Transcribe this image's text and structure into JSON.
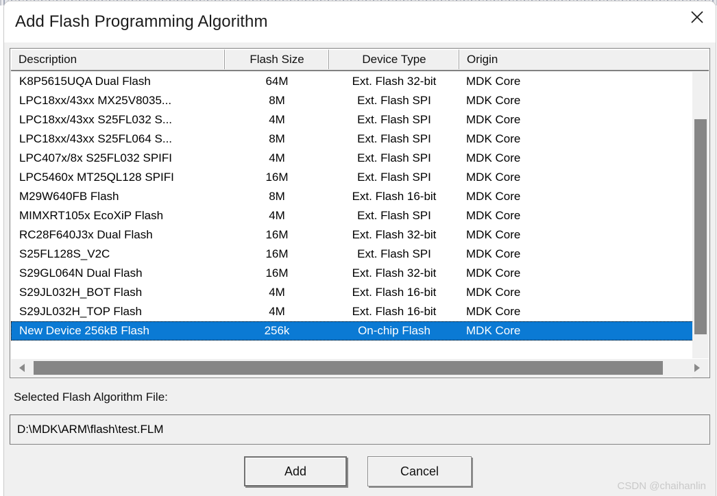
{
  "dialog": {
    "title": "Add Flash Programming Algorithm",
    "close_icon": "close-icon"
  },
  "table": {
    "columns": [
      "Description",
      "Flash Size",
      "Device Type",
      "Origin"
    ],
    "rows": [
      {
        "description": "K8P5615UQA Dual Flash",
        "flash_size": "64M",
        "device_type": "Ext. Flash 32-bit",
        "origin": "MDK Core",
        "selected": false
      },
      {
        "description": "LPC18xx/43xx MX25V8035...",
        "flash_size": "8M",
        "device_type": "Ext. Flash SPI",
        "origin": "MDK Core",
        "selected": false
      },
      {
        "description": "LPC18xx/43xx S25FL032 S...",
        "flash_size": "4M",
        "device_type": "Ext. Flash SPI",
        "origin": "MDK Core",
        "selected": false
      },
      {
        "description": "LPC18xx/43xx S25FL064 S...",
        "flash_size": "8M",
        "device_type": "Ext. Flash SPI",
        "origin": "MDK Core",
        "selected": false
      },
      {
        "description": "LPC407x/8x S25FL032 SPIFI",
        "flash_size": "4M",
        "device_type": "Ext. Flash SPI",
        "origin": "MDK Core",
        "selected": false
      },
      {
        "description": "LPC5460x MT25QL128 SPIFI",
        "flash_size": "16M",
        "device_type": "Ext. Flash SPI",
        "origin": "MDK Core",
        "selected": false
      },
      {
        "description": "M29W640FB Flash",
        "flash_size": "8M",
        "device_type": "Ext. Flash 16-bit",
        "origin": "MDK Core",
        "selected": false
      },
      {
        "description": "MIMXRT105x EcoXiP Flash",
        "flash_size": "4M",
        "device_type": "Ext. Flash SPI",
        "origin": "MDK Core",
        "selected": false
      },
      {
        "description": "RC28F640J3x Dual Flash",
        "flash_size": "16M",
        "device_type": "Ext. Flash 32-bit",
        "origin": "MDK Core",
        "selected": false
      },
      {
        "description": "S25FL128S_V2C",
        "flash_size": "16M",
        "device_type": "Ext. Flash SPI",
        "origin": "MDK Core",
        "selected": false
      },
      {
        "description": "S29GL064N Dual Flash",
        "flash_size": "16M",
        "device_type": "Ext. Flash 32-bit",
        "origin": "MDK Core",
        "selected": false
      },
      {
        "description": "S29JL032H_BOT Flash",
        "flash_size": "4M",
        "device_type": "Ext. Flash 16-bit",
        "origin": "MDK Core",
        "selected": false
      },
      {
        "description": "S29JL032H_TOP Flash",
        "flash_size": "4M",
        "device_type": "Ext. Flash 16-bit",
        "origin": "MDK Core",
        "selected": false
      },
      {
        "description": "New Device 256kB Flash",
        "flash_size": "256k",
        "device_type": "On-chip Flash",
        "origin": "MDK Core",
        "selected": true
      }
    ]
  },
  "selected_file": {
    "label": "Selected Flash Algorithm File:",
    "value": "D:\\MDK\\ARM\\flash\\test.FLM"
  },
  "buttons": {
    "add": "Add",
    "cancel": "Cancel"
  },
  "scrollbars": {
    "left_arrow_icon": "triangle-left-icon",
    "right_arrow_icon": "triangle-right-icon"
  },
  "watermark": "CSDN @chaihanlin",
  "colors": {
    "selection": "#0b7ad4",
    "dialog_face": "#f0f0f0",
    "scroll_thumb": "#868686"
  }
}
